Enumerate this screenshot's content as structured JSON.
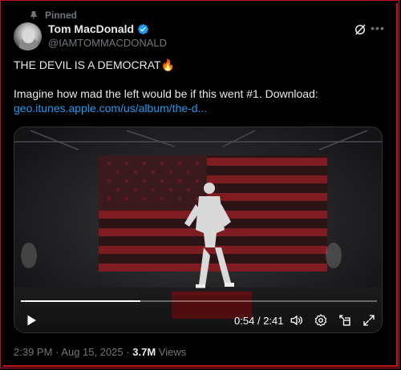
{
  "pinned": {
    "label": "Pinned",
    "icon": "pin-icon"
  },
  "author": {
    "name": "Tom MacDonald",
    "handle": "@IAMTOMMACDONALD",
    "verified": true,
    "verified_color": "#1d9bf0"
  },
  "post": {
    "line1": "THE DEVIL IS A DEMOCRAT",
    "emoji": "🔥",
    "line2": "Imagine how mad the left would be if this went #1. Download:",
    "link_text": "geo.itunes.apple.com/us/album/the-d..."
  },
  "video": {
    "current_time": "0:54",
    "separator": "/",
    "duration": "2:41",
    "progress": 0.335
  },
  "footer": {
    "time": "2:39 PM",
    "dot1": "·",
    "date": "Aug 15, 2025",
    "dot2": "·",
    "views_count": "3.7M",
    "views_label": "Views"
  },
  "colors": {
    "accent": "#1d9bf0",
    "background": "#000000",
    "frame": "#c0141a"
  }
}
